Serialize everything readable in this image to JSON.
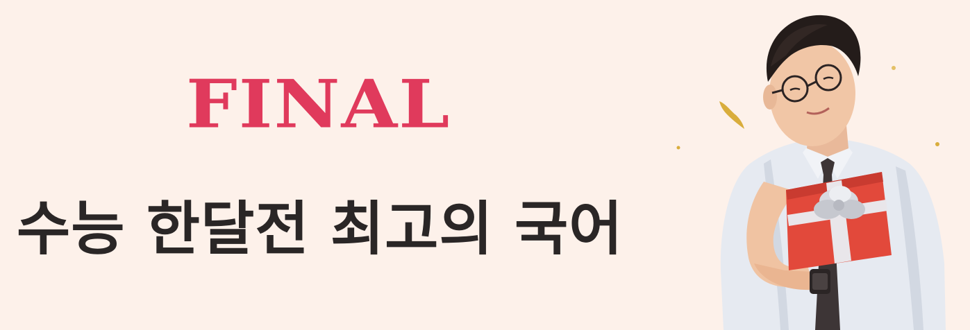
{
  "banner": {
    "title": "FINAL",
    "headline": "수능 한달전 최고의 국어"
  },
  "colors": {
    "background": "#fdf1ea",
    "title": "#e03a5c",
    "headline": "#2a2626"
  },
  "illustration": {
    "subject": "man-with-glasses-holding-gift-box",
    "decoration": "gold-confetti"
  }
}
